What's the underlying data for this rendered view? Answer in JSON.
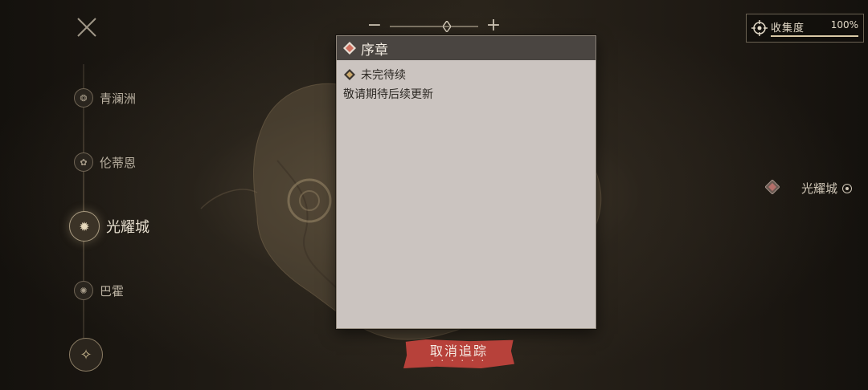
{
  "sidebar": {
    "regions": [
      {
        "label": "青澜洲"
      },
      {
        "label": "伦蒂恩"
      },
      {
        "label": "光耀城"
      },
      {
        "label": "巴霍"
      }
    ]
  },
  "collection": {
    "label": "收集度",
    "value": "100%",
    "progress": 1.0
  },
  "map": {
    "location_label": "光耀城"
  },
  "dialog": {
    "title": "序章",
    "status": "未完待续",
    "description": "敬请期待后续更新"
  },
  "action": {
    "cancel_label": "取消追踪",
    "dots": "• • • • • •"
  },
  "colors": {
    "accent_red": "#b7413a",
    "panel_bg": "#cbc4c0",
    "header_bg": "#4a4541"
  }
}
